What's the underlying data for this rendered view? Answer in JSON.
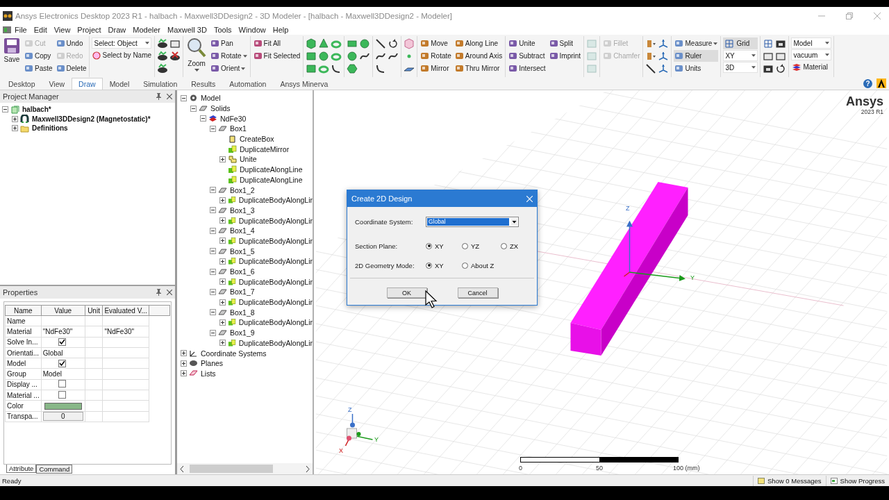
{
  "window": {
    "title": "Ansys Electronics Desktop 2023 R1 - halbach - Maxwell3DDesign2 - 3D Modeler - [halbach - Maxwell3DDesign2 - Modeler]"
  },
  "menu": [
    "File",
    "Edit",
    "View",
    "Project",
    "Draw",
    "Modeler",
    "Maxwell 3D",
    "Tools",
    "Window",
    "Help"
  ],
  "ribbon": [
    {
      "sections": [
        {
          "kind": "large",
          "label": "Save"
        },
        {
          "kind": "column",
          "items": [
            {
              "label": "Cut",
              "disabled": true
            },
            {
              "label": "Copy",
              "disabled": false
            },
            {
              "label": "Paste",
              "disabled": false
            }
          ]
        },
        {
          "kind": "column",
          "items": [
            {
              "label": "Undo",
              "disabled": false
            },
            {
              "label": "Redo",
              "disabled": true
            },
            {
              "label": "Delete",
              "disabled": false
            }
          ]
        }
      ]
    },
    {
      "sections": [
        {
          "kind": "select_column",
          "select": "Select: Object",
          "items": [
            {
              "label": "Select by Name"
            }
          ]
        }
      ]
    },
    {
      "sections": [
        {
          "kind": "view_icons"
        }
      ]
    },
    {
      "sections": [
        {
          "kind": "large",
          "label": "Zoom",
          "dropdown": true
        },
        {
          "kind": "column",
          "items": [
            {
              "label": "Pan"
            },
            {
              "label": "Rotate",
              "dropdown": true
            },
            {
              "label": "Orient",
              "dropdown": true
            }
          ]
        }
      ]
    },
    {
      "sections": [
        {
          "kind": "column",
          "items": [
            {
              "label": "Fit All"
            },
            {
              "label": "Fit Selected"
            }
          ]
        }
      ]
    },
    {
      "sections": [
        {
          "kind": "solid_icons"
        }
      ]
    },
    {
      "sections": [
        {
          "kind": "sheet_icons"
        }
      ]
    },
    {
      "sections": [
        {
          "kind": "line_icons"
        }
      ]
    },
    {
      "sections": [
        {
          "kind": "point_icons"
        }
      ]
    },
    {
      "sections": [
        {
          "kind": "column",
          "items": [
            {
              "label": "Move"
            },
            {
              "label": "Rotate"
            },
            {
              "label": "Mirror"
            }
          ]
        },
        {
          "kind": "column",
          "items": [
            {
              "label": "Along Line"
            },
            {
              "label": "Around Axis"
            },
            {
              "label": "Thru Mirror"
            }
          ]
        }
      ]
    },
    {
      "sections": [
        {
          "kind": "column",
          "items": [
            {
              "label": "Unite"
            },
            {
              "label": "Subtract"
            },
            {
              "label": "Intersect"
            }
          ]
        },
        {
          "kind": "column",
          "items": [
            {
              "label": "Split"
            },
            {
              "label": "Imprint"
            }
          ]
        }
      ]
    },
    {
      "sections": [
        {
          "kind": "face_icons"
        }
      ]
    },
    {
      "sections": [
        {
          "kind": "column",
          "items": [
            {
              "label": "Fillet",
              "disabled": true
            },
            {
              "label": "Chamfer",
              "disabled": true
            }
          ]
        }
      ]
    },
    {
      "sections": [
        {
          "kind": "snap_icons"
        }
      ]
    },
    {
      "sections": [
        {
          "kind": "column",
          "items": [
            {
              "label": "Measure",
              "dropdown": true,
              "on": false
            },
            {
              "label": "Ruler",
              "on": true
            },
            {
              "label": "Units",
              "on": false
            }
          ]
        }
      ]
    },
    {
      "sections": [
        {
          "kind": "grid_column",
          "toggle": {
            "label": "Grid",
            "on": true
          },
          "selects": [
            "XY",
            "3D"
          ]
        }
      ]
    },
    {
      "sections": [
        {
          "kind": "mode_icons"
        }
      ]
    },
    {
      "sections": [
        {
          "kind": "material_column",
          "selects": [
            "Model",
            "vacuum"
          ],
          "items": [
            {
              "label": "Material"
            }
          ]
        }
      ]
    }
  ],
  "tabs": [
    {
      "label": "Desktop",
      "selected": false
    },
    {
      "label": "View",
      "selected": false
    },
    {
      "label": "Draw",
      "selected": true
    },
    {
      "label": "Model",
      "selected": false
    },
    {
      "label": "Simulation",
      "selected": false
    },
    {
      "label": "Results",
      "selected": false
    },
    {
      "label": "Automation",
      "selected": false
    },
    {
      "label": "Ansys Minerva",
      "selected": false
    }
  ],
  "help": "?",
  "project_manager": {
    "title": "Project Manager",
    "tree": [
      {
        "label": "halbach*",
        "kind": "project",
        "expanded": true,
        "children": [
          {
            "label": "Maxwell3DDesign2 (Magnetostatic)*",
            "kind": "design",
            "expanded": false
          },
          {
            "label": "Definitions",
            "kind": "folder",
            "expanded": false
          }
        ]
      }
    ]
  },
  "properties": {
    "title": "Properties",
    "columns": [
      "Name",
      "Value",
      "Unit",
      "Evaluated V..."
    ],
    "rows": [
      {
        "name": "Name",
        "kind": "text"
      },
      {
        "name": "Material",
        "kind": "text",
        "value": "\"NdFe30\"",
        "evaluated": "\"NdFe30\""
      },
      {
        "name": "Solve In...",
        "kind": "check",
        "checked": true
      },
      {
        "name": "Orientati...",
        "kind": "text",
        "value": "Global"
      },
      {
        "name": "Model",
        "kind": "check",
        "checked": true
      },
      {
        "name": "Group",
        "kind": "text",
        "value": "Model"
      },
      {
        "name": "Display ...",
        "kind": "check",
        "checked": false
      },
      {
        "name": "Material ...",
        "kind": "check",
        "checked": false
      },
      {
        "name": "Color",
        "kind": "color",
        "color": "#88b788"
      },
      {
        "name": "Transpa...",
        "kind": "spin",
        "value": "0"
      }
    ],
    "tabs": [
      {
        "label": "Attribute",
        "selected": true
      },
      {
        "label": "Command",
        "selected": false
      }
    ]
  },
  "model_tree": [
    {
      "label": "Model",
      "kind": "model",
      "expanded": true,
      "children": [
        {
          "label": "Solids",
          "kind": "solid",
          "expanded": true,
          "children": [
            {
              "label": "NdFe30",
              "kind": "material",
              "expanded": true,
              "children": [
                {
                  "label": "Box1",
                  "kind": "solid",
                  "expanded": true,
                  "children": [
                    {
                      "label": "CreateBox",
                      "kind": "create"
                    },
                    {
                      "label": "DuplicateMirror",
                      "kind": "duplicate"
                    },
                    {
                      "label": "Unite",
                      "kind": "unite",
                      "expanded": false
                    },
                    {
                      "label": "DuplicateAlongLine",
                      "kind": "duplicate"
                    },
                    {
                      "label": "DuplicateAlongLine",
                      "kind": "duplicate"
                    }
                  ]
                },
                {
                  "label": "Box1_2",
                  "kind": "solid",
                  "expanded": true,
                  "children": [
                    {
                      "label": "DuplicateBodyAlongLir",
                      "kind": "duplicate",
                      "expanded": false
                    }
                  ]
                },
                {
                  "label": "Box1_3",
                  "kind": "solid",
                  "expanded": true,
                  "children": [
                    {
                      "label": "DuplicateBodyAlongLir",
                      "kind": "duplicate",
                      "expanded": false
                    }
                  ]
                },
                {
                  "label": "Box1_4",
                  "kind": "solid",
                  "expanded": true,
                  "children": [
                    {
                      "label": "DuplicateBodyAlongLir",
                      "kind": "duplicate",
                      "expanded": false
                    }
                  ]
                },
                {
                  "label": "Box1_5",
                  "kind": "solid",
                  "expanded": true,
                  "children": [
                    {
                      "label": "DuplicateBodyAlongLir",
                      "kind": "duplicate",
                      "expanded": false
                    }
                  ]
                },
                {
                  "label": "Box1_6",
                  "kind": "solid",
                  "expanded": true,
                  "children": [
                    {
                      "label": "DuplicateBodyAlongLir",
                      "kind": "duplicate",
                      "expanded": false
                    }
                  ]
                },
                {
                  "label": "Box1_7",
                  "kind": "solid",
                  "expanded": true,
                  "children": [
                    {
                      "label": "DuplicateBodyAlongLir",
                      "kind": "duplicate",
                      "expanded": false
                    }
                  ]
                },
                {
                  "label": "Box1_8",
                  "kind": "solid",
                  "expanded": true,
                  "children": [
                    {
                      "label": "DuplicateBodyAlongLir",
                      "kind": "duplicate",
                      "expanded": false
                    }
                  ]
                },
                {
                  "label": "Box1_9",
                  "kind": "solid",
                  "expanded": true,
                  "children": [
                    {
                      "label": "DuplicateBodyAlongLir",
                      "kind": "duplicate",
                      "expanded": false
                    }
                  ]
                }
              ]
            }
          ]
        }
      ]
    },
    {
      "label": "Coordinate Systems",
      "kind": "coords",
      "expanded": false
    },
    {
      "label": "Planes",
      "kind": "planes",
      "expanded": false
    },
    {
      "label": "Lists",
      "kind": "lists",
      "expanded": false
    }
  ],
  "viewport": {
    "logo": "Ansys",
    "version": "2023 R1",
    "axes": {
      "z": "Z",
      "y": "Y"
    },
    "triad": {
      "z": "Z",
      "y": "Y",
      "x": "X"
    },
    "scale": [
      "0",
      "50",
      "100 (mm)"
    ]
  },
  "dialog": {
    "title": "Create 2D Design",
    "coordinate_label": "Coordinate System:",
    "coordinate_value": "Global",
    "section_label": "Section Plane:",
    "section_options": [
      {
        "label": "XY",
        "selected": true
      },
      {
        "label": "YZ",
        "selected": false
      },
      {
        "label": "ZX",
        "selected": false
      }
    ],
    "mode_label": "2D Geometry Mode:",
    "mode_options": [
      {
        "label": "XY",
        "selected": true
      },
      {
        "label": "About Z",
        "selected": false
      }
    ],
    "buttons": [
      "OK",
      "Cancel"
    ]
  },
  "status_bar": {
    "text": "Ready",
    "messages": "Show 0 Messages",
    "progress": "Show Progress"
  }
}
